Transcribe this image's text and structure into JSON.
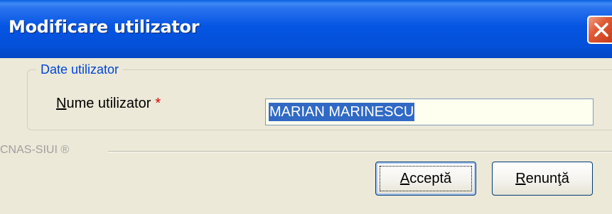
{
  "window": {
    "title": "Modificare utilizator",
    "close_icon": "close-icon"
  },
  "group": {
    "legend": "Date utilizator",
    "field_label_hotkey": "N",
    "field_label_rest": "ume utilizator",
    "required_marker": "*",
    "field_value": "MARIAN MARINESCU"
  },
  "footer": {
    "brand": "CNAS-SIUI ®"
  },
  "buttons": {
    "accept_hotkey": "A",
    "accept_rest": "cceptă",
    "cancel_hotkey": "R",
    "cancel_rest": "enunţă"
  },
  "colors": {
    "titlebar": "#0450d8",
    "legend_text": "#0046d5",
    "selection": "#316ac5",
    "required": "#e00000",
    "close_button": "#e05a35"
  }
}
